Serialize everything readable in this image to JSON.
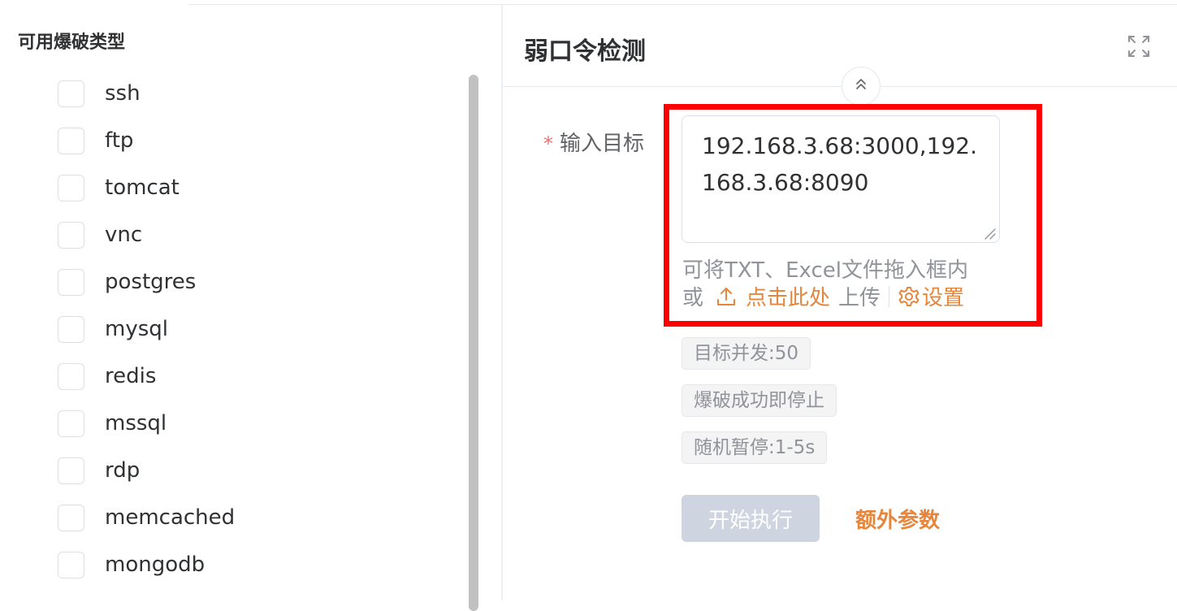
{
  "left": {
    "title": "可用爆破类型",
    "types": [
      {
        "label": "ssh"
      },
      {
        "label": "ftp"
      },
      {
        "label": "tomcat"
      },
      {
        "label": "vnc"
      },
      {
        "label": "postgres"
      },
      {
        "label": "mysql"
      },
      {
        "label": "redis"
      },
      {
        "label": "mssql"
      },
      {
        "label": "rdp"
      },
      {
        "label": "memcached"
      },
      {
        "label": "mongodb"
      }
    ]
  },
  "panel": {
    "title": "弱口令检测",
    "expand_icon": "expand-icon",
    "collapse_icon": "chevron-double-up-icon"
  },
  "form": {
    "required_mark": "*",
    "target_label": "输入目标",
    "target_value": "192.168.3.68:3000,192.168.3.68:8090",
    "hint_line1": "可将TXT、Excel文件拖入框内",
    "hint_or": "或",
    "upload_link": "点击此处",
    "upload_suffix": "上传",
    "settings_link": "设置"
  },
  "tags": {
    "concurrency": "目标并发:50",
    "stop_on_success": "爆破成功即停止",
    "random_pause": "随机暂停:1-5s"
  },
  "actions": {
    "start": "开始执行",
    "extra": "额外参数"
  },
  "colors": {
    "accent": "#e6863c",
    "highlight_box": "#ff0000",
    "required": "#f56c6c"
  }
}
